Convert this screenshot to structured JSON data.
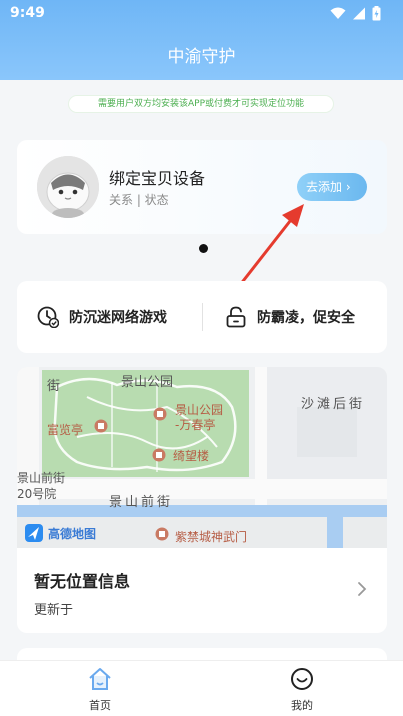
{
  "status_bar": {
    "time": "9:49"
  },
  "header": {
    "title": "中渝守护"
  },
  "notice": {
    "text": "需要用户双方均安装该APP或付费才可实现定位功能"
  },
  "device_card": {
    "title": "绑定宝贝设备",
    "subtitle": "关系 | 状态",
    "add_button": "去添加 ›"
  },
  "features": [
    {
      "label": "防沉迷网络游戏",
      "icon": "clock-check-icon"
    },
    {
      "label": "防霸凌，促安全",
      "icon": "unlock-icon"
    }
  ],
  "map": {
    "labels": {
      "jingshan_park": "景山公园",
      "wanchun_1": "景山公园",
      "wanchun_2": "-万春亭",
      "fulan": "富览亭",
      "qiwang": "绮望楼",
      "qianjie": "景山前街",
      "addr1": "景山前街",
      "addr2": "20号院",
      "shatan": "沙滩后街",
      "shenwu": "紫禁城神武门",
      "street_top": "街",
      "logo": "高德地图"
    }
  },
  "location": {
    "title": "暂无位置信息",
    "updated": "更新于"
  },
  "tabbar": {
    "items": [
      {
        "label": "首页",
        "icon": "home-icon",
        "active": true
      },
      {
        "label": "我的",
        "icon": "smile-icon",
        "active": false
      }
    ]
  },
  "colors": {
    "header_blue": "#6fb6f6",
    "accent_green": "#4caf50",
    "arrow_red": "#e53b2e"
  }
}
